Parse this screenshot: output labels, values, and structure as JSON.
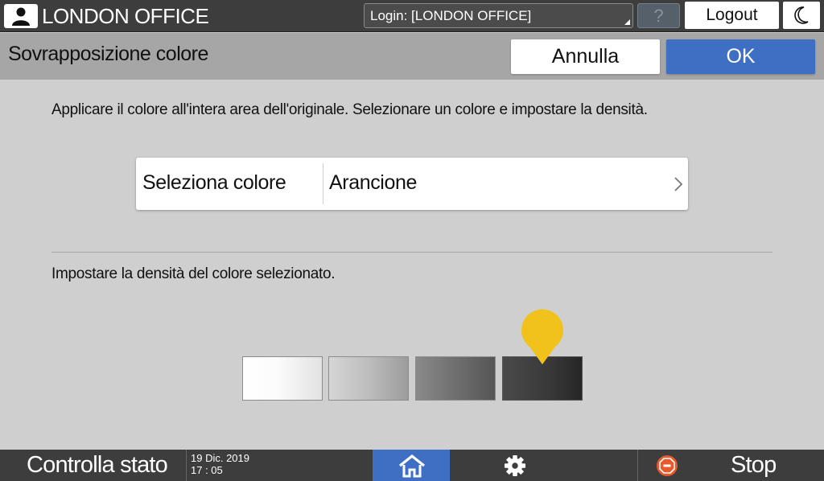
{
  "topbar": {
    "office_name": "LONDON OFFICE",
    "login_text": "Login: [LONDON OFFICE]",
    "help_label": "?",
    "logout_label": "Logout"
  },
  "header": {
    "title": "Sovrapposizione colore",
    "cancel_label": "Annulla",
    "ok_label": "OK"
  },
  "main": {
    "instruction": "Applicare il colore all'intera area dell'originale. Selezionare un colore e impostare la densità.",
    "color_select": {
      "label": "Seleziona colore",
      "value": "Arancione"
    },
    "density_label": "Impostare la densità del colore selezionato.",
    "density": {
      "levels": 4,
      "selected_level": 4
    }
  },
  "footer": {
    "status_label": "Controlla stato",
    "date": "19 Dic. 2019",
    "time": "17 : 05",
    "stop_label": "Stop"
  },
  "colors": {
    "accent_blue": "#3f6fc2",
    "marker_yellow": "#f1c21b",
    "stop_red": "#e8592b"
  },
  "icons": [
    "user-icon",
    "dropdown-corner-icon",
    "moon-icon",
    "chevron-right-icon",
    "pin-marker-icon",
    "home-icon",
    "gear-icon",
    "stop-icon"
  ]
}
